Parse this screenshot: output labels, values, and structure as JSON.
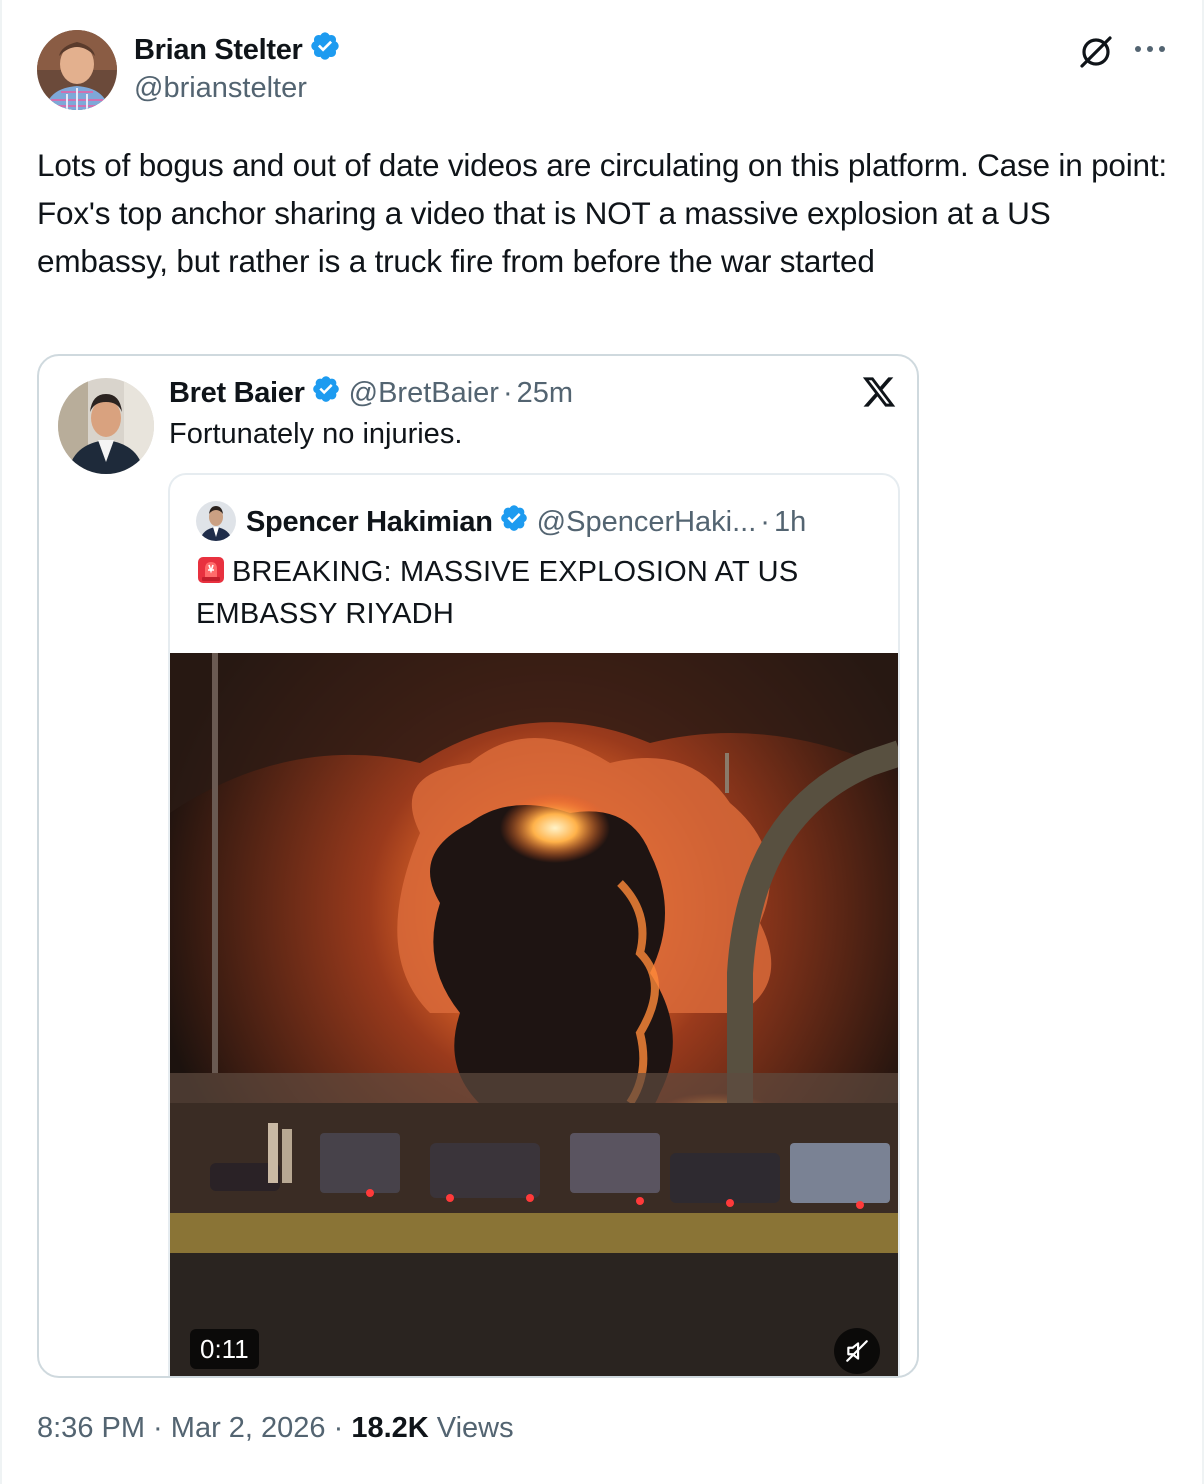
{
  "author": {
    "name": "Brian Stelter",
    "handle": "@brianstelter"
  },
  "tweet": {
    "text": "Lots of bogus and out of date videos are circulating on this platform. Case in point: Fox's top anchor sharing a video that is NOT a massive explosion at a US embassy, but rather is a truck fire from before the war started"
  },
  "quote": {
    "name": "Bret Baier",
    "handle": "@BretBaier",
    "separator": "·",
    "time": "25m",
    "text": "Fortunately no injuries.",
    "inner": {
      "name": "Spencer Hakimian",
      "handle": "@SpencerHaki...",
      "separator": "·",
      "time": "1h",
      "text": "BREAKING: MASSIVE EXPLOSION AT US EMBASSY RIYADH",
      "video_duration": "0:11"
    }
  },
  "meta": {
    "time": "8:36 PM",
    "separator1": " · ",
    "date": "Mar 2, 2026",
    "separator2": " · ",
    "views_count": "18.2K",
    "views_label": " Views"
  },
  "colors": {
    "verified": "#1d9bf0",
    "secondary_text": "#536471",
    "border": "#cfd9de"
  },
  "icons": [
    "verified-badge-icon",
    "grok-icon",
    "more-icon",
    "x-logo-icon",
    "siren-emoji-icon",
    "mute-icon"
  ]
}
